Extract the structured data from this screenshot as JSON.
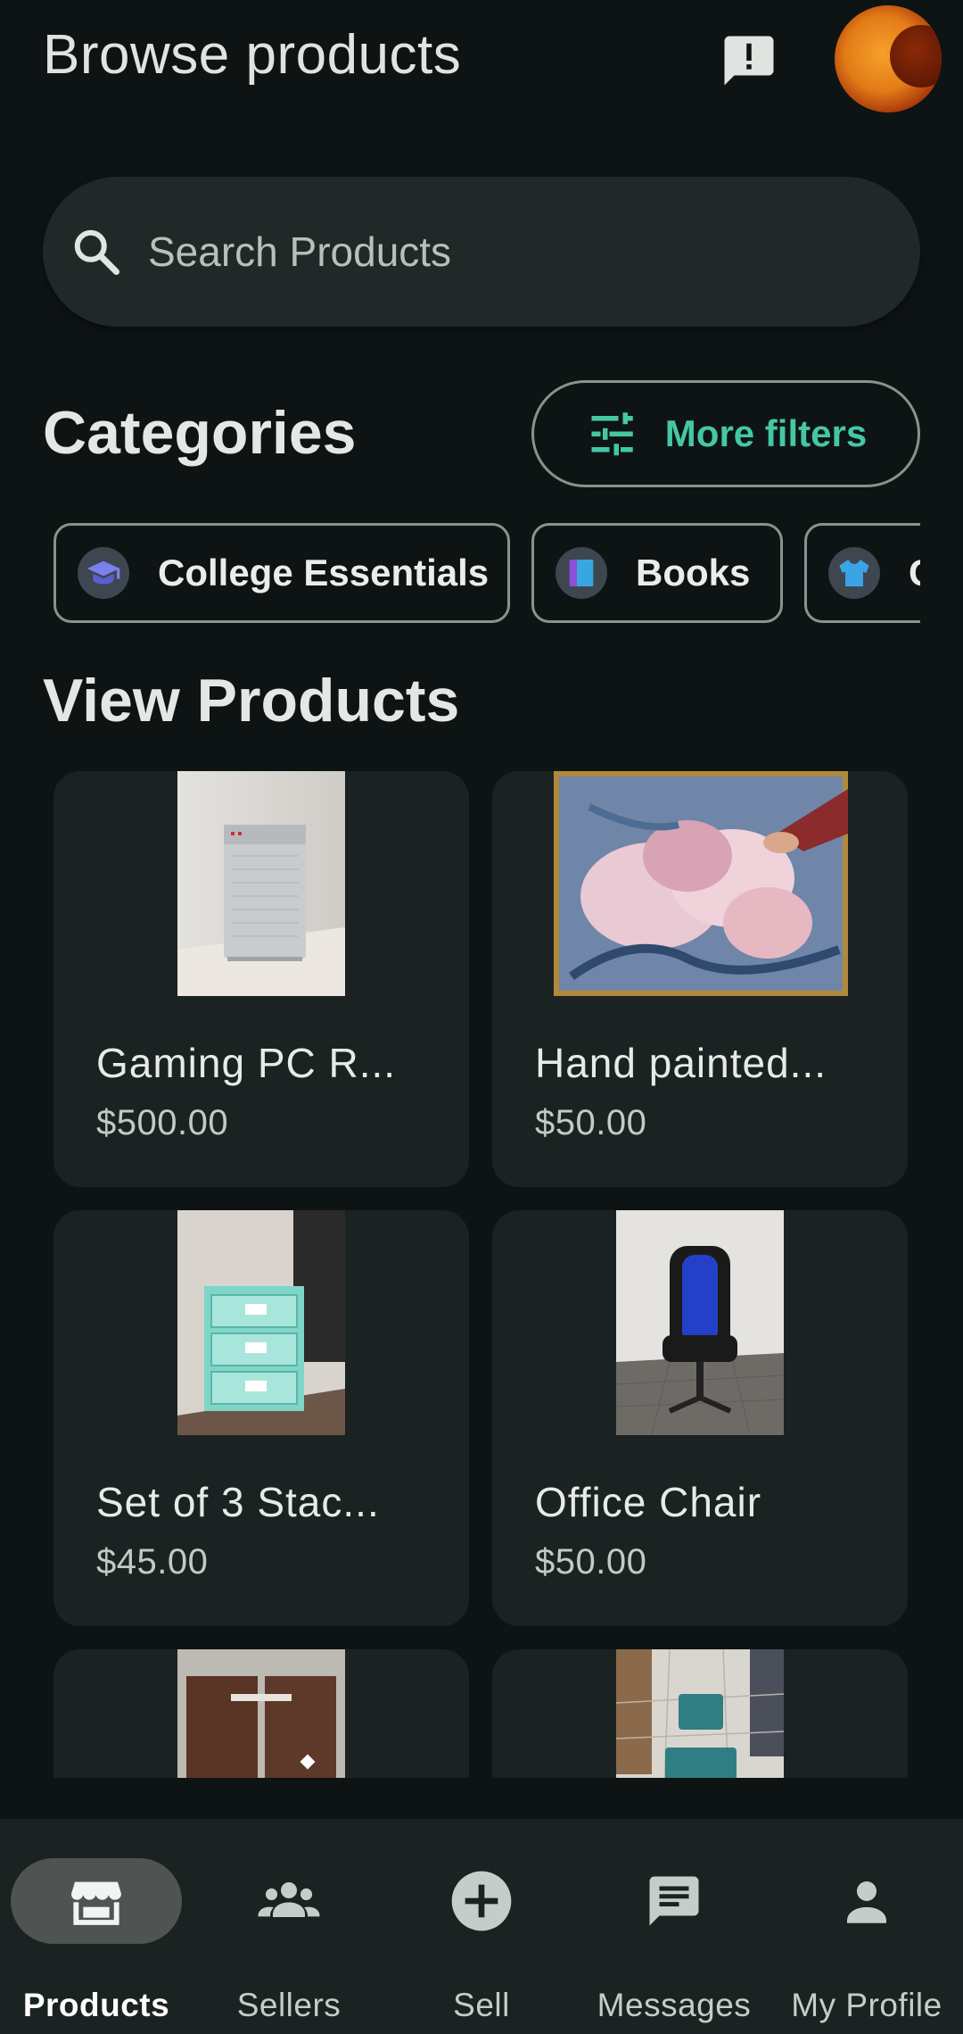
{
  "header": {
    "title": "Browse products",
    "feedback_icon": "feedback-icon",
    "avatar_icon": "avatar"
  },
  "search": {
    "placeholder": "Search Products",
    "value": ""
  },
  "categories": {
    "title": "Categories",
    "more_filters_label": "More filters",
    "chips": [
      {
        "label": "College Essentials",
        "icon": "graduation-cap-icon"
      },
      {
        "label": "Books",
        "icon": "books-icon"
      },
      {
        "label": "Clothing",
        "icon": "sweater-icon"
      }
    ]
  },
  "products": {
    "title": "View Products",
    "items": [
      {
        "name": "Gaming PC R...",
        "price": "$500.00"
      },
      {
        "name": "Hand painted...",
        "price": "$50.00"
      },
      {
        "name": "Set of 3 Stac...",
        "price": "$45.00"
      },
      {
        "name": "Office Chair",
        "price": "$50.00"
      },
      {
        "name": "",
        "price": ""
      },
      {
        "name": "",
        "price": ""
      }
    ]
  },
  "bottom_nav": {
    "items": [
      {
        "label": "Products",
        "icon": "storefront-icon",
        "active": true
      },
      {
        "label": "Sellers",
        "icon": "group-icon",
        "active": false
      },
      {
        "label": "Sell",
        "icon": "add-circle-icon",
        "active": false
      },
      {
        "label": "Messages",
        "icon": "message-icon",
        "active": false
      },
      {
        "label": "My Profile",
        "icon": "person-icon",
        "active": false
      }
    ]
  },
  "colors": {
    "background": "#0e1414",
    "surface": "#1b2222",
    "accent": "#45c7a5"
  }
}
